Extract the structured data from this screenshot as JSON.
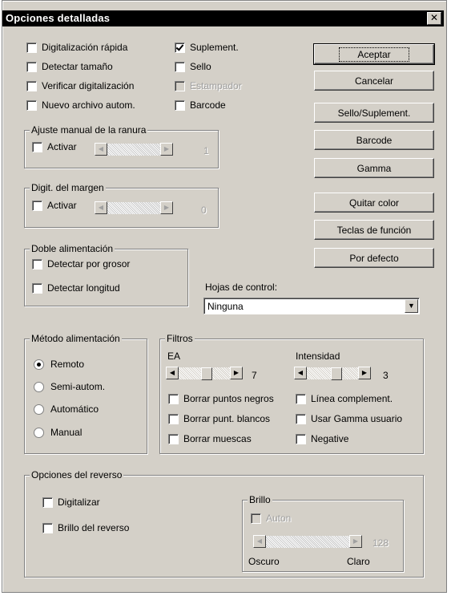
{
  "dialog": {
    "title": "Opciones detalladas",
    "close_label": "✕"
  },
  "top_checks": [
    {
      "label": "Digitalización rápida",
      "checked": false
    },
    {
      "label": "Detectar tamaño",
      "checked": false
    },
    {
      "label": "Verificar digitalización",
      "checked": false
    },
    {
      "label": "Nuevo archivo autom.",
      "checked": false
    }
  ],
  "mid_checks": [
    {
      "label": "Suplement.",
      "checked": true
    },
    {
      "label": "Sello",
      "checked": false
    },
    {
      "label": "Estampador",
      "checked": false,
      "disabled": true
    },
    {
      "label": "Barcode",
      "checked": false
    }
  ],
  "buttons": {
    "accept": "Aceptar",
    "cancel": "Cancelar",
    "stamp": "Sello/Suplement.",
    "barcode": "Barcode",
    "gamma": "Gamma",
    "remove_color": "Quitar color",
    "function_keys": "Teclas de función",
    "default": "Por defecto"
  },
  "slot_adjust": {
    "legend": "Ajuste manual de la ranura",
    "activate": "Activar",
    "value": "1"
  },
  "margin_scan": {
    "legend": "Digit. del margen",
    "activate": "Activar",
    "value": "0"
  },
  "double_feed": {
    "legend": "Doble alimentación",
    "by_thickness": "Detectar por grosor",
    "by_length": "Detectar longitud"
  },
  "control_sheets": {
    "label": "Hojas de control:",
    "value": "Ninguna"
  },
  "feed_method": {
    "legend": "Método alimentación",
    "options": [
      "Remoto",
      "Semi-autom.",
      "Automático",
      "Manual"
    ],
    "selected": "Remoto"
  },
  "filters": {
    "legend": "Filtros",
    "ea_label": "EA",
    "ea_value": "7",
    "intensity_label": "Intensidad",
    "intensity_value": "3",
    "checks": [
      {
        "label": "Borrar puntos negros"
      },
      {
        "label": "Borrar punt. blancos"
      },
      {
        "label": "Borrar muescas"
      },
      {
        "label": "Línea complement."
      },
      {
        "label": "Usar Gamma usuario"
      },
      {
        "label": "Negative"
      }
    ]
  },
  "reverse": {
    "legend": "Opciones del reverso",
    "scan": "Digitalizar",
    "brightness_reverse": "Brillo del reverso",
    "brightness": {
      "legend": "Brillo",
      "auto": "Auton",
      "value": "128",
      "dark": "Oscuro",
      "light": "Claro"
    }
  }
}
